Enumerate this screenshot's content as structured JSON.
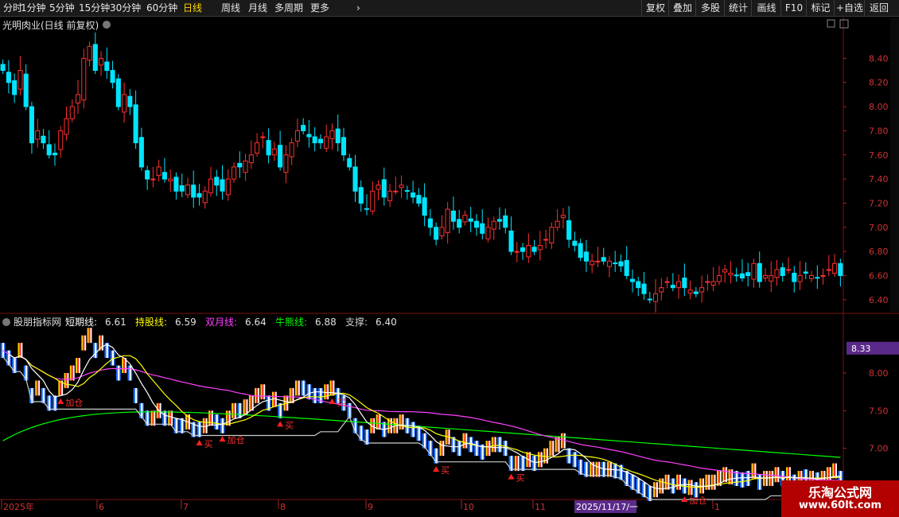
{
  "toolbar": {
    "left_items": [
      "分时",
      "1分钟",
      "5分钟",
      "15分钟",
      "30分钟",
      "60分钟",
      "日线",
      "周线",
      "月线",
      "多周期",
      "更多"
    ],
    "active": "日线",
    "more_arrow": "chevron-right-icon",
    "right_items": [
      "复权",
      "叠加",
      "多股",
      "统计",
      "画线",
      "F10",
      "标记",
      "+自选",
      "返回"
    ]
  },
  "main_panel": {
    "title": "光明肉业(日线 前复权)",
    "y_ticks": [
      "8.40",
      "8.20",
      "8.00",
      "7.80",
      "7.60",
      "7.40",
      "7.20",
      "7.00",
      "6.80",
      "6.60",
      "6.40"
    ]
  },
  "indicator_panel": {
    "name": "股朋指标网",
    "lines": [
      {
        "label": "短期线:",
        "value": "6.61",
        "color": "#ffffff"
      },
      {
        "label": "持股线:",
        "value": "6.59",
        "color": "#ffff00"
      },
      {
        "label": "双月线:",
        "value": "6.64",
        "color": "#ff40ff"
      },
      {
        "label": "牛熊线:",
        "value": "6.88",
        "color": "#00ff00"
      },
      {
        "label": "支撑:",
        "value": "6.40",
        "color": "#cccccc"
      }
    ],
    "y_ticks": [
      "8.00",
      "7.50",
      "7.00"
    ],
    "cursor_value": "8.33",
    "signals": [
      "加仓",
      "买",
      "加仓",
      "买",
      "买",
      "买",
      "买",
      "加仓"
    ]
  },
  "x_axis": {
    "labels": [
      "2025年",
      "6",
      "7",
      "8",
      "9",
      "10",
      "11",
      "1"
    ],
    "cursor_date": "2025/11/17/一"
  },
  "watermark": {
    "line1": "乐淘公式网",
    "line2": "www.60lt.com"
  },
  "colors": {
    "up": "#ff3030",
    "down": "#00e5ff",
    "grid": "#7a1212",
    "accent": "#ffd400"
  },
  "chart_data": {
    "type": "candlestick",
    "title": "光明肉业(日线 前复权)",
    "ylim": [
      6.3,
      8.62
    ],
    "close": [
      8.3,
      8.2,
      8.1,
      8.3,
      8.0,
      7.7,
      7.8,
      7.7,
      7.6,
      7.6,
      7.8,
      7.9,
      8.0,
      8.1,
      8.4,
      8.5,
      8.3,
      8.4,
      8.3,
      8.2,
      8.0,
      8.1,
      8.0,
      7.7,
      7.5,
      7.4,
      7.4,
      7.5,
      7.4,
      7.4,
      7.3,
      7.3,
      7.35,
      7.25,
      7.25,
      7.3,
      7.4,
      7.35,
      7.3,
      7.4,
      7.5,
      7.5,
      7.55,
      7.6,
      7.7,
      7.75,
      7.6,
      7.65,
      7.5,
      7.6,
      7.7,
      7.8,
      7.8,
      7.75,
      7.7,
      7.7,
      7.75,
      7.8,
      7.7,
      7.6,
      7.5,
      7.3,
      7.2,
      7.15,
      7.3,
      7.35,
      7.25,
      7.3,
      7.3,
      7.35,
      7.3,
      7.25,
      7.2,
      7.1,
      7.0,
      6.9,
      7.0,
      7.15,
      7.05,
      7.0,
      7.1,
      7.05,
      7.0,
      6.95,
      7.0,
      7.05,
      7.05,
      7.0,
      6.8,
      6.8,
      6.8,
      6.85,
      6.8,
      6.85,
      6.9,
      7.0,
      7.05,
      7.1,
      6.9,
      6.85,
      6.75,
      6.72,
      6.72,
      6.72,
      6.72,
      6.72,
      6.7,
      6.68,
      6.6,
      6.55,
      6.5,
      6.45,
      6.4,
      6.45,
      6.5,
      6.55,
      6.5,
      6.55,
      6.5,
      6.48,
      6.45,
      6.5,
      6.55,
      6.55,
      6.6,
      6.65,
      6.62,
      6.6,
      6.58,
      6.6,
      6.7,
      6.55,
      6.6,
      6.6,
      6.65,
      6.6,
      6.65,
      6.55,
      6.6,
      6.62,
      6.6,
      6.58,
      6.6,
      6.65,
      6.7,
      6.6
    ],
    "cursor_value": 8.33,
    "lines": {
      "短期线": 6.61,
      "持股线": 6.59,
      "双月线": 6.64,
      "牛熊线": 6.88,
      "支撑": 6.4
    }
  }
}
